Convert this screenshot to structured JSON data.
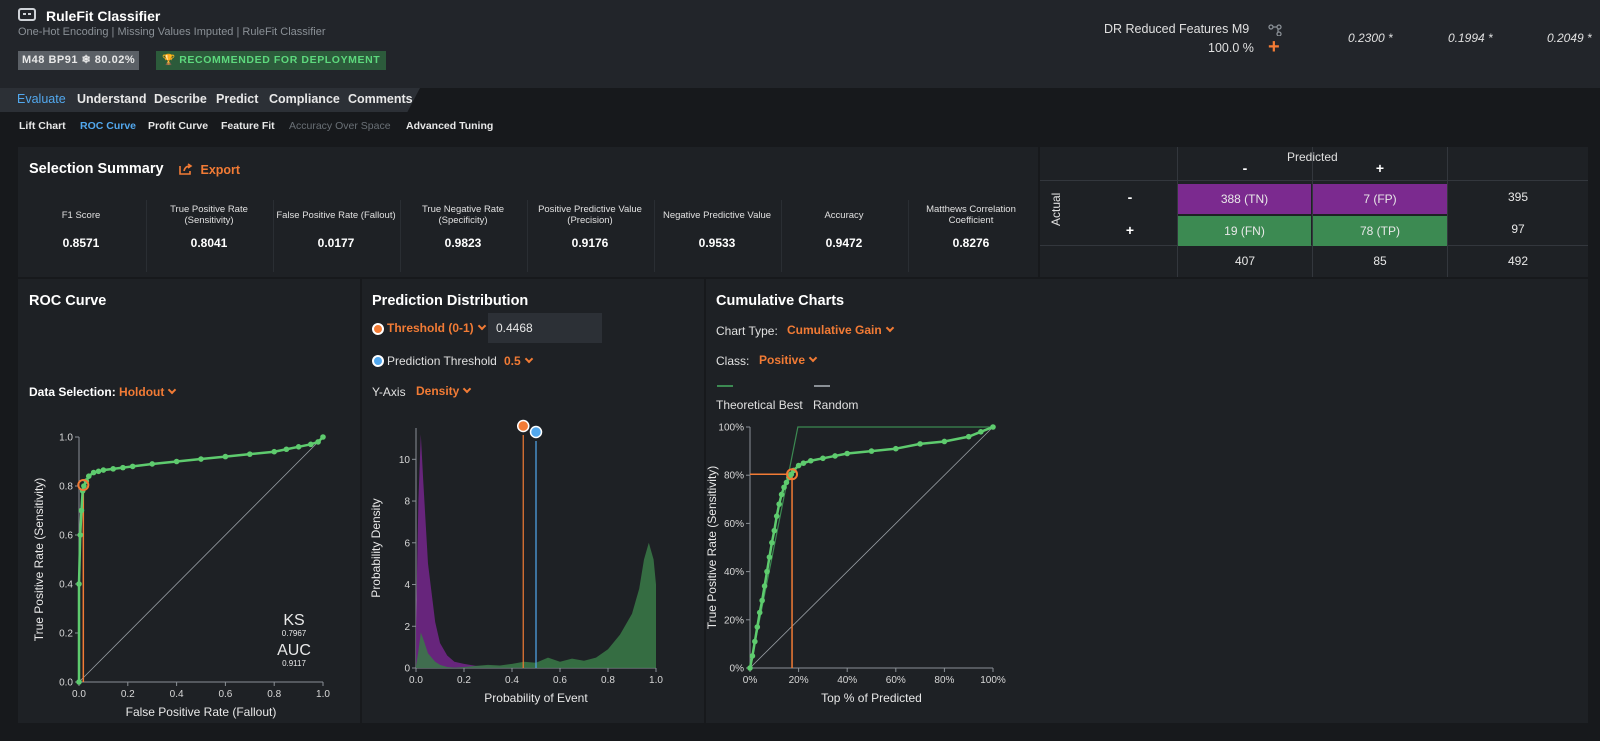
{
  "header": {
    "title": "RuleFit Classifier",
    "subtitle": "One-Hot Encoding | Missing Values Imputed | RuleFit Classifier",
    "model_badge": "M48  BP91  ❄ 80.02%",
    "deploy_badge": "RECOMMENDED FOR DEPLOYMENT",
    "dataset_name": "DR Reduced Features M9",
    "dataset_pct": "100.0 %",
    "scores": [
      "0.2300 *",
      "0.1994 *",
      "0.2049 *"
    ]
  },
  "nav": {
    "tabs": [
      {
        "label": "Evaluate",
        "active": true
      },
      {
        "label": "Understand"
      },
      {
        "label": "Describe"
      },
      {
        "label": "Predict"
      },
      {
        "label": "Compliance"
      },
      {
        "label": "Comments"
      }
    ],
    "subtabs": [
      {
        "label": "Lift Chart"
      },
      {
        "label": "ROC Curve",
        "active": true
      },
      {
        "label": "Profit Curve"
      },
      {
        "label": "Feature Fit"
      },
      {
        "label": "Accuracy Over Space",
        "disabled": true
      },
      {
        "label": "Advanced Tuning"
      }
    ]
  },
  "summary": {
    "title": "Selection Summary",
    "export_label": "Export",
    "metrics": [
      {
        "label": "F1 Score",
        "value": "0.8571"
      },
      {
        "label": "True Positive Rate (Sensitivity)",
        "value": "0.8041"
      },
      {
        "label": "False Positive Rate (Fallout)",
        "value": "0.0177"
      },
      {
        "label": "True Negative Rate (Specificity)",
        "value": "0.9823"
      },
      {
        "label": "Positive Predictive Value (Precision)",
        "value": "0.9176"
      },
      {
        "label": "Negative Predictive Value",
        "value": "0.9533"
      },
      {
        "label": "Accuracy",
        "value": "0.9472"
      },
      {
        "label": "Matthews Correlation Coefficient",
        "value": "0.8276"
      }
    ]
  },
  "confusion": {
    "predicted_label": "Predicted",
    "actual_label": "Actual",
    "minus": "-",
    "plus": "+",
    "tn": "388 (TN)",
    "fp": "7 (FP)",
    "fn": "19 (FN)",
    "tp": "78 (TP)",
    "row_totals": [
      "395",
      "97"
    ],
    "col_totals": [
      "407",
      "85"
    ],
    "total": "492",
    "colors": {
      "negative": "#7b2a8f",
      "positive": "#3c8a52"
    }
  },
  "roc": {
    "title": "ROC Curve",
    "data_selection_label": "Data Selection:",
    "data_selection_value": "Holdout",
    "ks_label": "KS",
    "ks_value": "0.7967",
    "auc_label": "AUC",
    "auc_value": "0.9117"
  },
  "dist": {
    "title": "Prediction Distribution",
    "threshold_label": "Threshold (0-1)",
    "threshold_value": "0.4468",
    "pred_threshold_label": "Prediction Threshold",
    "pred_threshold_value": "0.5",
    "yaxis_label": "Y-Axis",
    "yaxis_value": "Density"
  },
  "cumulative": {
    "title": "Cumulative Charts",
    "chart_type_label": "Chart Type:",
    "chart_type_value": "Cumulative Gain",
    "class_label": "Class:",
    "class_value": "Positive",
    "legend": [
      "Theoretical Best",
      "Random"
    ]
  },
  "chart_data": [
    {
      "type": "line",
      "xlabel": "False Positive Rate (Fallout)",
      "ylabel": "True Positive Rate (Sensitivity)",
      "xlim": [
        0,
        1
      ],
      "ylim": [
        0,
        1
      ],
      "ticks": [
        "0.0",
        "0.2",
        "0.4",
        "0.6",
        "0.8",
        "1.0"
      ],
      "x": [
        0,
        0,
        0.005,
        0.01,
        0.015,
        0.02,
        0.03,
        0.04,
        0.06,
        0.08,
        0.1,
        0.14,
        0.18,
        0.22,
        0.3,
        0.4,
        0.5,
        0.6,
        0.7,
        0.8,
        0.85,
        0.9,
        0.95,
        0.98,
        1
      ],
      "y": [
        0,
        0.4,
        0.6,
        0.7,
        0.78,
        0.8,
        0.82,
        0.84,
        0.855,
        0.86,
        0.865,
        0.87,
        0.875,
        0.88,
        0.89,
        0.9,
        0.91,
        0.92,
        0.93,
        0.94,
        0.95,
        0.96,
        0.97,
        0.98,
        1
      ],
      "selected_point": [
        0.0177,
        0.8041
      ]
    },
    {
      "type": "area",
      "xlabel": "Probability of Event",
      "ylabel": "Probability Density",
      "xlim": [
        0,
        1
      ],
      "ylim": [
        0,
        11.5
      ],
      "xticks": [
        "0.0",
        "0.2",
        "0.4",
        "0.6",
        "0.8",
        "1.0"
      ],
      "yticks": [
        "0",
        "2",
        "4",
        "6",
        "8",
        "10"
      ],
      "x": [
        0,
        0.01,
        0.02,
        0.03,
        0.05,
        0.08,
        0.1,
        0.13,
        0.16,
        0.2,
        0.25,
        0.3,
        0.35,
        0.4,
        0.45,
        0.5,
        0.55,
        0.6,
        0.65,
        0.7,
        0.75,
        0.8,
        0.85,
        0.88,
        0.9,
        0.93,
        0.95,
        0.97,
        0.99,
        1
      ],
      "series": [
        {
          "values": [
            2,
            8,
            11.2,
            9,
            5,
            2.2,
            1.2,
            0.6,
            0.3,
            0.2,
            0.1,
            0.08,
            0.06,
            0.05,
            0.05,
            0.03,
            0.02,
            0.02,
            0.01,
            0.01,
            0.01,
            0.01,
            0.01,
            0.01,
            0.01,
            0.01,
            0.01,
            0.01,
            0.01,
            0
          ]
        },
        {
          "values": [
            0.1,
            0.8,
            1.7,
            1.4,
            0.7,
            0.3,
            0.15,
            0.05,
            0.02,
            0.05,
            0.1,
            0.15,
            0.12,
            0.2,
            0.3,
            0.25,
            0.5,
            0.3,
            0.45,
            0.35,
            0.5,
            0.9,
            1.6,
            2.2,
            2.6,
            3.8,
            5.2,
            6.0,
            5.2,
            4.0
          ]
        }
      ],
      "threshold": 0.4468,
      "prediction_threshold": 0.5
    },
    {
      "type": "line",
      "xlabel": "Top % of Predicted",
      "ylabel": "True Positive Rate (Sensitivity)",
      "xlim": [
        0,
        100
      ],
      "ylim": [
        0,
        100
      ],
      "ticks": [
        "0%",
        "20%",
        "40%",
        "60%",
        "80%",
        "100%"
      ],
      "x": [
        0,
        1,
        2,
        3,
        4,
        5,
        6,
        7,
        8,
        9,
        10,
        11,
        12,
        13,
        14,
        15,
        16,
        17,
        18,
        20,
        22,
        25,
        30,
        35,
        40,
        50,
        60,
        70,
        80,
        90,
        95,
        100
      ],
      "y": [
        0,
        5,
        11,
        17,
        23,
        28,
        34,
        40,
        46,
        52,
        57,
        63,
        68,
        72,
        75,
        77,
        79,
        80.4,
        82,
        84,
        85,
        86,
        87,
        88,
        89,
        90,
        91,
        93,
        94,
        96,
        98,
        100
      ],
      "theoretical_best": [
        [
          0,
          0
        ],
        [
          19.7,
          100
        ],
        [
          100,
          100
        ]
      ],
      "selected_point": [
        17.3,
        80.4
      ]
    }
  ]
}
